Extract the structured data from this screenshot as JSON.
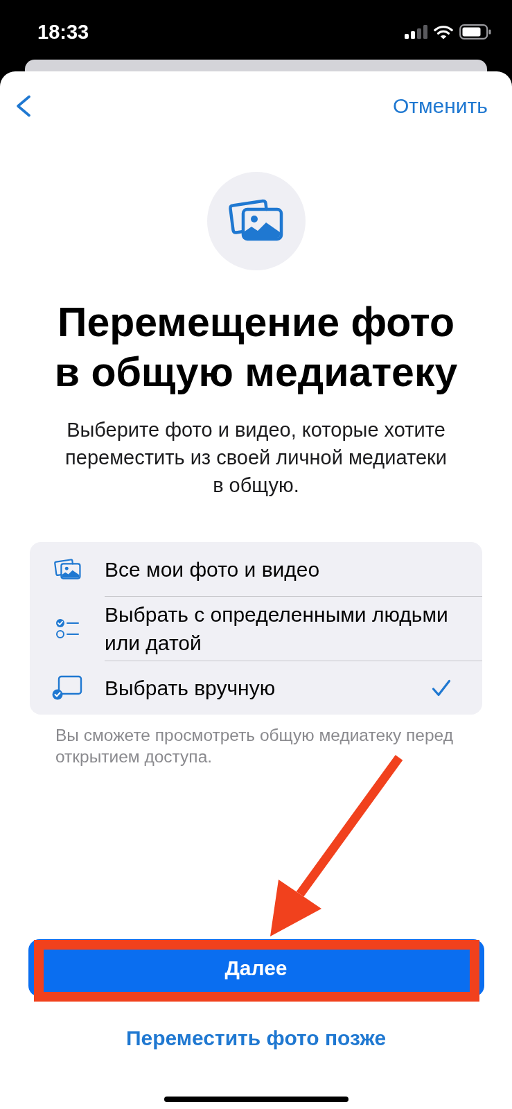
{
  "status_bar": {
    "time": "18:33"
  },
  "nav": {
    "cancel": "Отменить"
  },
  "header": {
    "title": "Перемещение фото в общую медиатеку",
    "subtitle": "Выберите фото и видео, которые хотите переместить из своей личной медиатеки в общую."
  },
  "options": [
    {
      "kind": "all",
      "label": "Все мои фото и видео",
      "selected": false
    },
    {
      "kind": "people",
      "label": "Выбрать с определенными людьми или датой",
      "selected": false
    },
    {
      "kind": "manual",
      "label": "Выбрать вручную",
      "selected": true
    }
  ],
  "footnote": "Вы сможете просмотреть общую медиатеку перед открытием доступа.",
  "buttons": [
    {
      "kind": "primary",
      "label": "Далее"
    },
    {
      "kind": "secondary",
      "label": "Переместить фото позже"
    }
  ],
  "annotation": {
    "arrow": true,
    "frame": true
  }
}
